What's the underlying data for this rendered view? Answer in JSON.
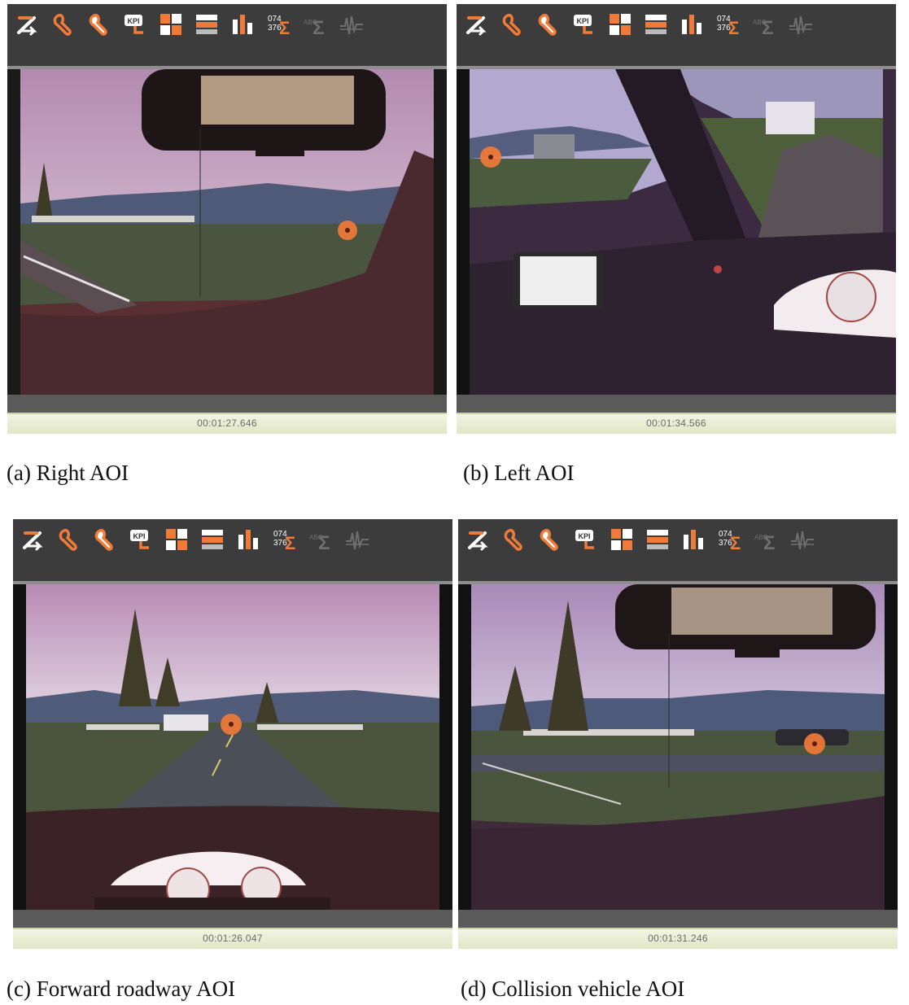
{
  "toolbar": {
    "icons": [
      {
        "name": "replay-path-icon",
        "enabled": true
      },
      {
        "name": "gaze-plot-icon",
        "enabled": true
      },
      {
        "name": "heatmap-icon",
        "enabled": true
      },
      {
        "name": "kpi-icon",
        "label": "KPI",
        "enabled": true
      },
      {
        "name": "grid-aoi-icon",
        "enabled": true
      },
      {
        "name": "bar-aoi-icon",
        "enabled": true
      },
      {
        "name": "bar-chart-icon",
        "enabled": true
      },
      {
        "name": "statistics-icon",
        "label_top": "074",
        "label_bottom": "376",
        "enabled": true
      },
      {
        "name": "abc-sum-icon",
        "label": "ABC",
        "enabled": false
      },
      {
        "name": "signal-icon",
        "enabled": false
      }
    ]
  },
  "panels": [
    {
      "id": "a",
      "timestamp": "00:01:27.646",
      "caption": "(a) Right AOI"
    },
    {
      "id": "b",
      "timestamp": "00:01:34.566",
      "caption": "(b) Left AOI"
    },
    {
      "id": "c",
      "timestamp": "00:01:26.047",
      "caption": "(c) Forward roadway AOI"
    },
    {
      "id": "d",
      "timestamp": "00:01:31.246",
      "caption": "(d) Collision vehicle AOI"
    }
  ],
  "colors": {
    "accent": "#f07a38",
    "toolbar_bg": "#3c3c3c",
    "timebar_bg": "#e9eed4"
  }
}
